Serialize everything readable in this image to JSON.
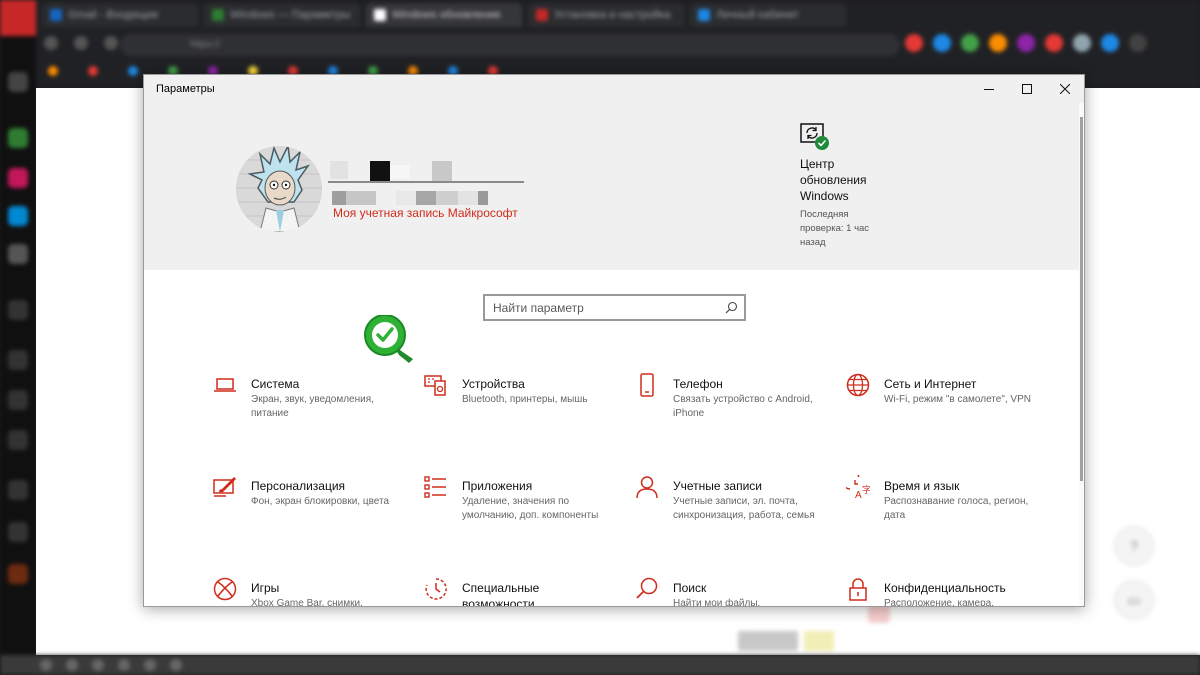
{
  "window": {
    "title": "Параметры",
    "controls": [
      "minimize-icon",
      "maximize-icon",
      "close-icon"
    ]
  },
  "account": {
    "link": "Моя учетная запись Майкрософт"
  },
  "update": {
    "title": "Центр обновления Windows",
    "status": "Последняя проверка: 1 час назад",
    "icon": "sync-check-icon"
  },
  "search": {
    "placeholder": "Найти параметр",
    "icon": "search-icon"
  },
  "categories": [
    {
      "title": "Система",
      "desc": "Экран, звук, уведомления, питание",
      "icon": "laptop-icon"
    },
    {
      "title": "Устройства",
      "desc": "Bluetooth, принтеры, мышь",
      "icon": "devices-icon"
    },
    {
      "title": "Телефон",
      "desc": "Связать устройство с Android, iPhone",
      "icon": "phone-icon"
    },
    {
      "title": "Сеть и Интернет",
      "desc": "Wi-Fi, режим \"в самолете\", VPN",
      "icon": "globe-icon"
    },
    {
      "title": "Персонализация",
      "desc": "Фон, экран блокировки, цвета",
      "icon": "paintbrush-icon"
    },
    {
      "title": "Приложения",
      "desc": "Удаление, значения по умолчанию, доп. компоненты",
      "icon": "apps-list-icon"
    },
    {
      "title": "Учетные записи",
      "desc": "Учетные записи, эл. почта, синхронизация, работа, семья",
      "icon": "person-icon"
    },
    {
      "title": "Время и язык",
      "desc": "Распознавание голоса, регион, дата",
      "icon": "time-language-icon"
    },
    {
      "title": "Игры",
      "desc": "Xbox Game Bar, снимки,",
      "icon": "xbox-icon"
    },
    {
      "title": "Специальные возможности",
      "desc": "",
      "icon": "accessibility-icon"
    },
    {
      "title": "Поиск",
      "desc": "Найти мои файлы,",
      "icon": "search-icon"
    },
    {
      "title": "Конфиденциальность",
      "desc": "Расположение, камера,",
      "icon": "lock-icon"
    }
  ],
  "colors": {
    "accent": "#d02c1c",
    "header_bg": "#f0f0f0",
    "badge": "#2eb135"
  }
}
